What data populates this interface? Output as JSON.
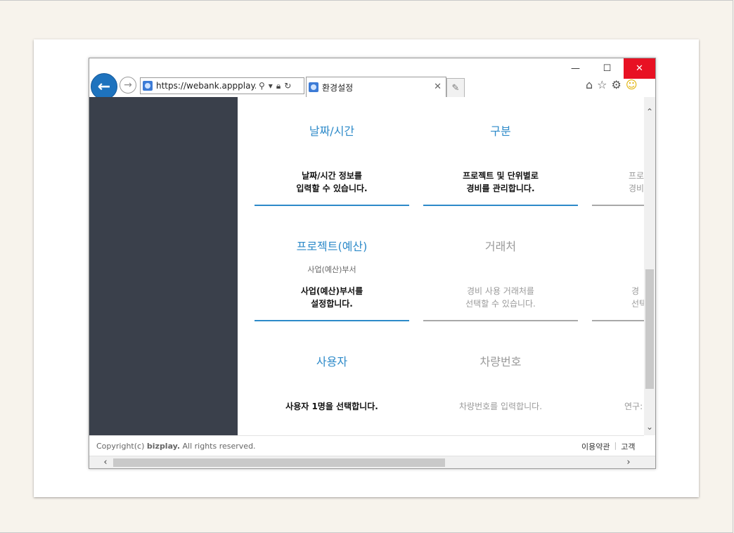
{
  "browser": {
    "window_controls": {
      "minimize": "—",
      "maximize": "☐",
      "close": "✕"
    },
    "address_bar": {
      "url": "https://webank.appplay..."
    },
    "tab": {
      "title": "환경설정"
    },
    "toolbar_icons": [
      "home-icon",
      "star-icon",
      "gear-icon",
      "smiley-icon"
    ]
  },
  "tiles": [
    {
      "title": "날짜/시간",
      "subtitle": "",
      "desc": "날짜/시간 정보를\n입력할 수 있습니다.",
      "state": "active"
    },
    {
      "title": "구분",
      "subtitle": "",
      "desc": "프로젝트 및 단위별로\n경비를 관리합니다.",
      "state": "active"
    },
    {
      "title": "",
      "subtitle": "",
      "desc": "프로\n경비",
      "state": "inactive"
    },
    {
      "title": "프로젝트(예산)",
      "subtitle": "사업(예산)부서",
      "desc": "사업(예산)부서를\n설정합니다.",
      "state": "active"
    },
    {
      "title": "거래처",
      "subtitle": "",
      "desc": "경비 사용 거래처를\n선택할 수 있습니다.",
      "state": "inactive"
    },
    {
      "title": "",
      "subtitle": "",
      "desc": "경\n선택",
      "state": "inactive"
    },
    {
      "title": "사용자",
      "subtitle": "",
      "desc": "사용자 1명을 선택합니다.",
      "state": "active"
    },
    {
      "title": "차량번호",
      "subtitle": "",
      "desc": "차량번호를 입력합니다.",
      "state": "inactive"
    },
    {
      "title": "",
      "subtitle": "",
      "desc": "연구:",
      "state": "inactive"
    }
  ],
  "footer": {
    "copyright_prefix": "Copyright(c) ",
    "brand": "bizplay.",
    "copyright_suffix": " All rights reserved.",
    "links": [
      "이용약관",
      "고객"
    ]
  },
  "colors": {
    "accent": "#2d8ac9",
    "sidebar": "#3a404b",
    "close": "#e81123"
  }
}
